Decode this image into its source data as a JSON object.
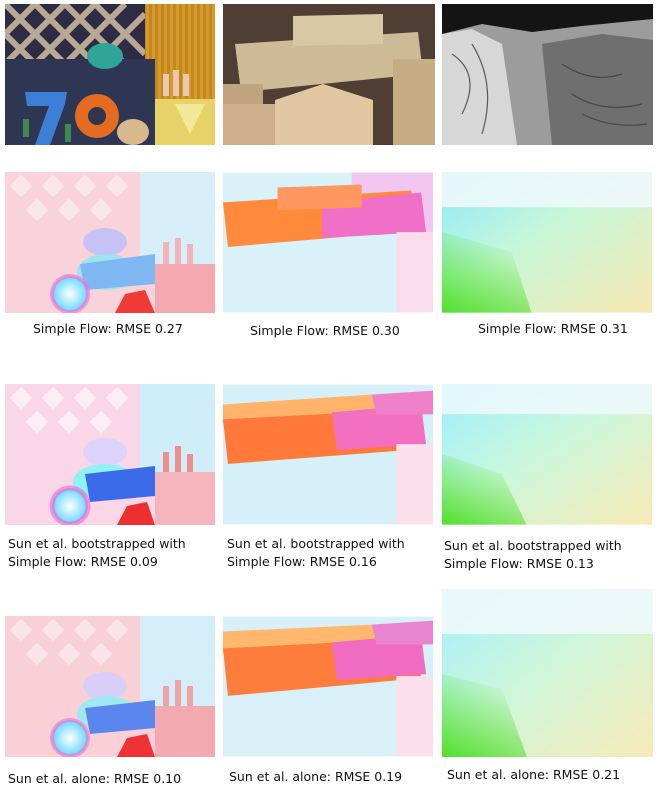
{
  "captions": {
    "simple_flow_1": "Simple Flow: RMSE 0.27",
    "simple_flow_2": "Simple Flow: RMSE 0.30",
    "simple_flow_3": "Simple Flow: RMSE 0.31",
    "bootstrapped_1": "Sun et al. bootstrapped with\nSimple Flow: RMSE 0.09",
    "bootstrapped_2": "Sun et al. bootstrapped with\nSimple Flow: RMSE 0.16",
    "bootstrapped_3": "Sun et al. bootstrapped with\nSimple Flow: RMSE 0.13",
    "alone_1": "Sun et al. alone: RMSE 0.10",
    "alone_2": "Sun et al. alone: RMSE 0.19",
    "alone_3": "Sun et al. alone: RMSE 0.21"
  }
}
